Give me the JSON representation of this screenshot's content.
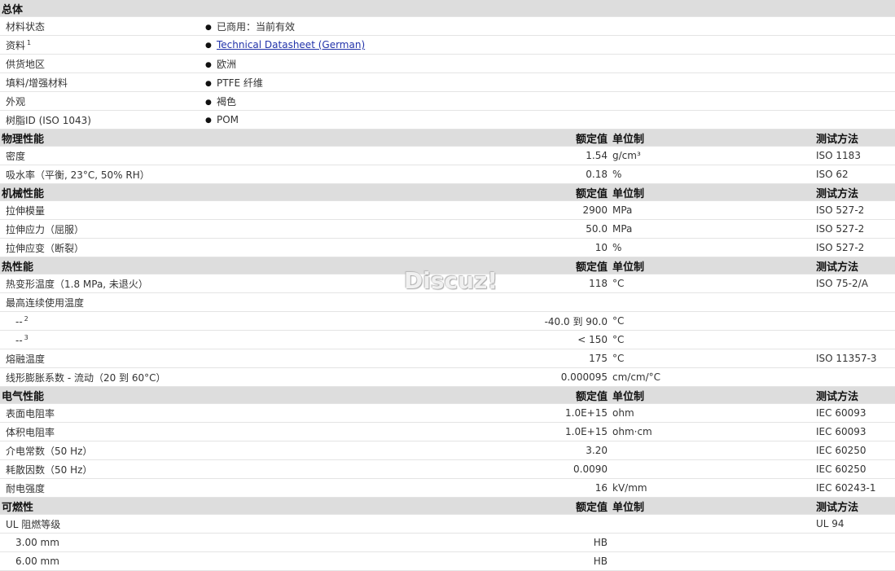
{
  "general": {
    "title": "总体",
    "rows": [
      {
        "label": "材料状态",
        "value": "已商用：当前有效"
      },
      {
        "label": "资料",
        "sup": "1",
        "value": "Technical Datasheet (German)",
        "link": true
      },
      {
        "label": "供货地区",
        "value": "欧洲"
      },
      {
        "label": "填料/增强材料",
        "value": "PTFE 纤维"
      },
      {
        "label": "外观",
        "value": "褐色"
      },
      {
        "label": "树脂ID (ISO 1043)",
        "value": "POM"
      }
    ]
  },
  "headers": {
    "value": "额定值",
    "unit": "单位制",
    "method": "测试方法"
  },
  "sections": [
    {
      "title": "物理性能",
      "rows": [
        {
          "label": "密度",
          "value": "1.54",
          "unit": "g/cm³",
          "method": "ISO 1183"
        },
        {
          "label": "吸水率（平衡, 23°C, 50% RH）",
          "value": "0.18",
          "unit": "%",
          "method": "ISO 62"
        }
      ]
    },
    {
      "title": "机械性能",
      "rows": [
        {
          "label": "拉伸模量",
          "value": "2900",
          "unit": "MPa",
          "method": "ISO 527-2"
        },
        {
          "label": "拉伸应力（屈服）",
          "value": "50.0",
          "unit": "MPa",
          "method": "ISO 527-2"
        },
        {
          "label": "拉伸应变（断裂）",
          "value": "10",
          "unit": "%",
          "method": "ISO 527-2"
        }
      ]
    },
    {
      "title": "热性能",
      "rows": [
        {
          "label": "热变形温度（1.8 MPa, 未退火）",
          "value": "118",
          "unit": "°C",
          "method": "ISO 75-2/A"
        },
        {
          "label": "最高连续使用温度",
          "value": "",
          "unit": "",
          "method": ""
        },
        {
          "label": "--",
          "sup": "2",
          "indent": true,
          "value": "-40.0 到  90.0",
          "unit": "°C",
          "method": ""
        },
        {
          "label": "--",
          "sup": "3",
          "indent": true,
          "value": "< 150",
          "unit": "°C",
          "method": ""
        },
        {
          "label": "熔融温度",
          "value": "175",
          "unit": "°C",
          "method": "ISO 11357-3"
        },
        {
          "label": "线形膨胀系数 - 流动（20 到  60°C）",
          "value": "0.000095",
          "unit": "cm/cm/°C",
          "method": ""
        }
      ]
    },
    {
      "title": "电气性能",
      "rows": [
        {
          "label": "表面电阻率",
          "value": "1.0E+15",
          "unit": "ohm",
          "method": "IEC 60093"
        },
        {
          "label": "体积电阻率",
          "value": "1.0E+15",
          "unit": "ohm·cm",
          "method": "IEC 60093"
        },
        {
          "label": "介电常数（50 Hz）",
          "value": "3.20",
          "unit": "",
          "method": "IEC 60250"
        },
        {
          "label": "耗散因数（50 Hz）",
          "value": "0.0090",
          "unit": "",
          "method": "IEC 60250"
        },
        {
          "label": "耐电强度",
          "value": "16",
          "unit": "kV/mm",
          "method": "IEC 60243-1"
        }
      ]
    },
    {
      "title": "可燃性",
      "rows": [
        {
          "label": "UL 阻燃等级",
          "value": "",
          "unit": "",
          "method": "UL 94"
        },
        {
          "label": "3.00 mm",
          "indent": true,
          "value": "HB",
          "unit": "",
          "method": ""
        },
        {
          "label": "6.00 mm",
          "indent": true,
          "value": "HB",
          "unit": "",
          "method": ""
        }
      ]
    }
  ],
  "watermark": "Discuz!"
}
